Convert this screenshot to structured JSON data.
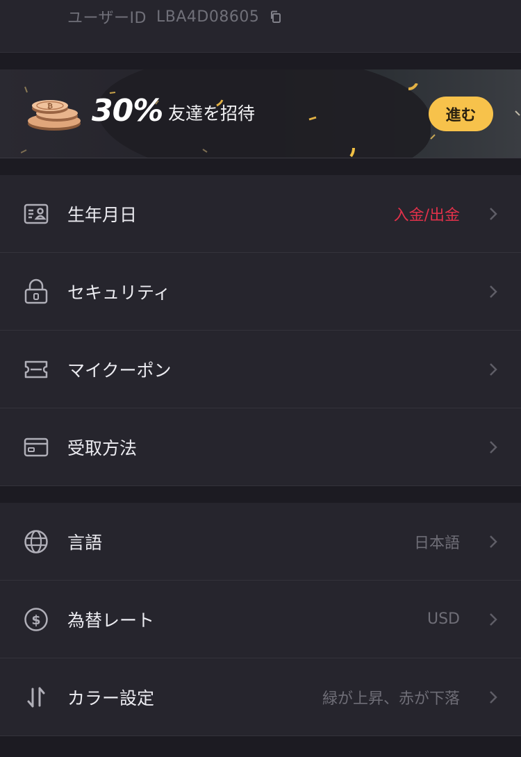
{
  "user": {
    "id_label": "ユーザーID",
    "id_value": "LBA4D08605"
  },
  "banner": {
    "percent": "30%",
    "text": "友達を招待",
    "button_label": "進む"
  },
  "account_menu": [
    {
      "label": "生年月日",
      "value": "入金/出金",
      "icon": "id-card-icon"
    },
    {
      "label": "セキュリティ",
      "value": "",
      "icon": "lock-icon"
    },
    {
      "label": "マイクーポン",
      "value": "",
      "icon": "coupon-icon"
    },
    {
      "label": "受取方法",
      "value": "",
      "icon": "card-icon"
    }
  ],
  "settings_menu": [
    {
      "label": "言語",
      "value": "日本語",
      "icon": "globe-icon"
    },
    {
      "label": "為替レート",
      "value": "USD",
      "icon": "dollar-circle-icon"
    },
    {
      "label": "カラー設定",
      "value": "緑が上昇、赤が下落",
      "icon": "updown-arrows-icon"
    }
  ],
  "colors": {
    "accent_yellow": "#f7c24b",
    "value_red": "#e0314a",
    "background": "#1c1b22",
    "card": "#26252d"
  }
}
